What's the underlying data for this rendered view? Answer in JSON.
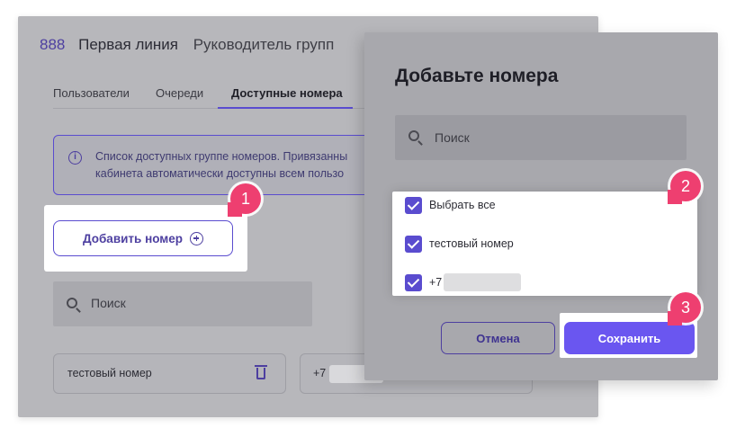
{
  "header": {
    "number": "888",
    "line_name": "Первая линия",
    "role": "Руководитель групп"
  },
  "tabs": [
    {
      "label": "Пользователи"
    },
    {
      "label": "Очереди"
    },
    {
      "label": "Доступные номера",
      "active": true
    }
  ],
  "info": {
    "line1": "Список доступных группе номеров. Привязанны",
    "line2": "кабинета автоматически доступны всем пользо"
  },
  "add_button": {
    "label": "Добавить номер"
  },
  "search_back": {
    "placeholder": "Поиск"
  },
  "cards": [
    {
      "label": "тестовый номер"
    },
    {
      "label": "+7"
    }
  ],
  "modal": {
    "title": "Добавьте номера",
    "search_placeholder": "Поиск",
    "options": [
      {
        "label": "Выбрать все",
        "checked": true
      },
      {
        "label": "тестовый номер",
        "checked": true
      },
      {
        "label": "+7",
        "checked": true
      }
    ],
    "cancel_label": "Отмена",
    "save_label": "Сохранить"
  },
  "markers": [
    "1",
    "2",
    "3"
  ],
  "colors": {
    "accent": "#5a4ccf",
    "save_button": "#6a56f0",
    "marker": "#ee3f70"
  }
}
